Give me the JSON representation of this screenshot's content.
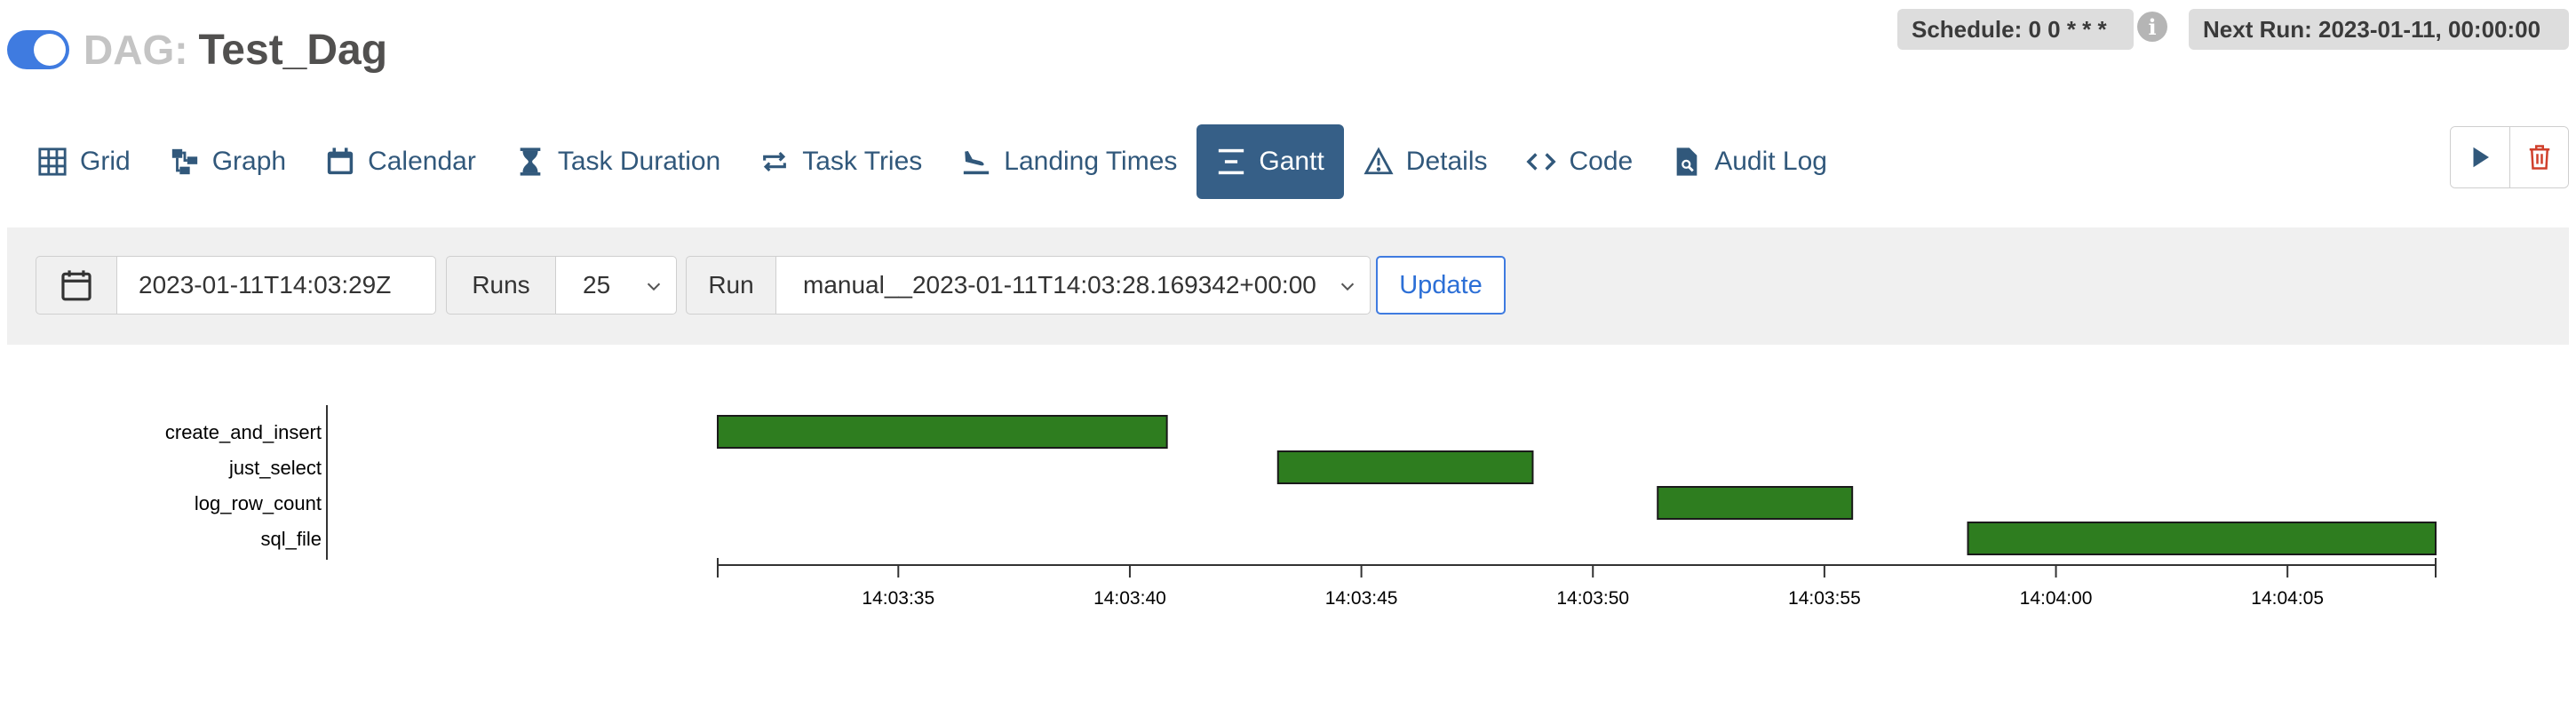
{
  "header": {
    "dag_prefix": "DAG:",
    "dag_name": "Test_Dag",
    "schedule": "Schedule: 0 0 * * *",
    "next_run": "Next Run: 2023-01-11, 00:00:00",
    "toggle_on": true
  },
  "nav": {
    "tabs": [
      {
        "label": "Grid",
        "icon": "grid-icon"
      },
      {
        "label": "Graph",
        "icon": "graph-icon"
      },
      {
        "label": "Calendar",
        "icon": "calendar-icon"
      },
      {
        "label": "Task Duration",
        "icon": "hourglass-icon"
      },
      {
        "label": "Task Tries",
        "icon": "repeat-icon"
      },
      {
        "label": "Landing Times",
        "icon": "plane-landing-icon"
      },
      {
        "label": "Gantt",
        "icon": "gantt-icon",
        "active": true
      },
      {
        "label": "Details",
        "icon": "warning-triangle-icon"
      },
      {
        "label": "Code",
        "icon": "code-icon"
      },
      {
        "label": "Audit Log",
        "icon": "file-search-icon"
      }
    ],
    "actions": [
      {
        "name": "trigger-dag",
        "icon": "play-icon"
      },
      {
        "name": "delete-dag",
        "icon": "trash-icon"
      }
    ]
  },
  "filters": {
    "base_date": "2023-01-11T14:03:29Z",
    "runs_label": "Runs",
    "runs_value": "25",
    "run_label": "Run",
    "run_value": "manual__2023-01-11T14:03:28.169342+00:00",
    "update_label": "Update"
  },
  "colors": {
    "accent": "#365f87",
    "success": "#2e7d1f",
    "link": "#3f7be0"
  },
  "chart_data": {
    "type": "gantt",
    "tasks": [
      {
        "name": "create_and_insert",
        "start": "14:03:31.1",
        "end": "14:03:40.8",
        "state": "success"
      },
      {
        "name": "just_select",
        "start": "14:03:43.2",
        "end": "14:03:48.7",
        "state": "success"
      },
      {
        "name": "log_row_count",
        "start": "14:03:51.4",
        "end": "14:03:55.6",
        "state": "success"
      },
      {
        "name": "sql_file",
        "start": "14:03:58.1",
        "end": "14:04:08.2",
        "state": "success"
      }
    ],
    "x_ticks": [
      "14:03:35",
      "14:03:40",
      "14:03:45",
      "14:03:50",
      "14:03:55",
      "14:04:00",
      "14:04:05"
    ],
    "x_range": [
      "14:03:31.1",
      "14:04:08.2"
    ]
  }
}
